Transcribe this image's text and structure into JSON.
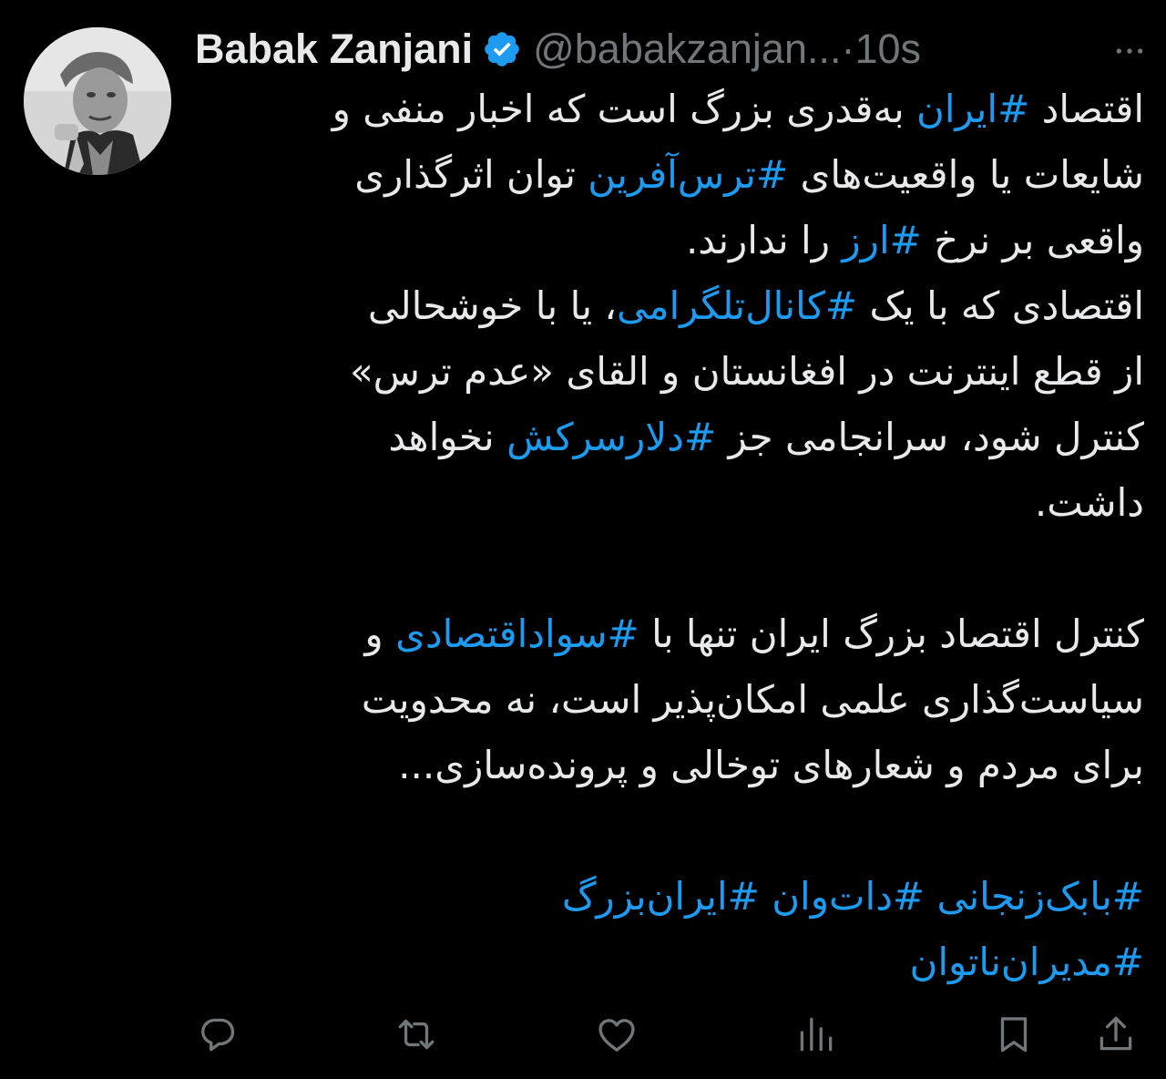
{
  "author": {
    "name": "Babak Zanjani",
    "handle": "@babakzanjan...",
    "separator": "·",
    "time": "10s"
  },
  "icons": {
    "verified": "verified-badge-icon",
    "more": "more-horizontal-icon",
    "reply": "reply-icon",
    "retweet": "retweet-icon",
    "like": "heart-icon",
    "views": "views-bar-chart-icon",
    "bookmark": "bookmark-icon",
    "share": "share-icon"
  },
  "colors": {
    "background": "#000000",
    "text": "#e7e9ea",
    "muted": "#71767b",
    "hashtag": "#1d9bf0",
    "verified": "#1d9bf0"
  },
  "tweet": {
    "l1": {
      "a": "اقتصاد ",
      "t1": "#ایران",
      "b": " به‌قدری بزرگ است که اخبار منفی و"
    },
    "l2": {
      "a": "شایعات یا واقعیت‌های  ",
      "t1": "#ترس‌آفرین",
      "b": " توان اثرگذاری"
    },
    "l3": {
      "a": "واقعی بر نرخ ",
      "t1": "#ارز",
      "b": " را ندارند."
    },
    "l4": {
      "a": "اقتصادی که با یک ",
      "t1": "#کانال‌تلگرامی",
      "b": "، یا با خوشحالی"
    },
    "l5": {
      "a": "از قطع اینترنت در افغانستان و القای «عدم ترس»"
    },
    "l6": {
      "a": "کنترل شود، سرانجامی جز ",
      "t1": "#دلارسرکش",
      "b": " نخواهد"
    },
    "l7": {
      "a": "داشت."
    },
    "l8": {
      "a": "کنترل اقتصاد بزرگ ایران تنها با ",
      "t1": "#سواداقتصادی",
      "b": " و"
    },
    "l9": {
      "a": "سیاست‌گذاری علمی امکان‌پذیر است، نه محدویت"
    },
    "l10": {
      "a": "برای مردم و شعارهای توخالی و پرونده‌سازی..."
    },
    "l11": {
      "t1": "#بابک‌زنجانی",
      "s1": " ",
      "t2": "#دات‌وان",
      "s2": " ",
      "t3": "#ایران‌بزرگ"
    },
    "l12": {
      "t1": "#مدیران‌ناتوان"
    }
  }
}
